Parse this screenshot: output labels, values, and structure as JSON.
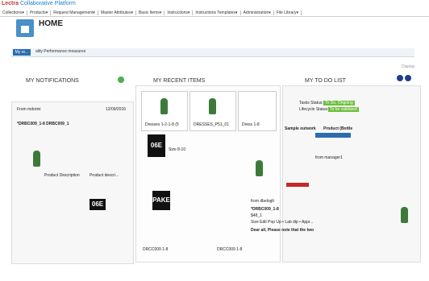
{
  "app": {
    "brand_prefix": "Lectra",
    "brand_name": "Collaborative Platform"
  },
  "topnav": [
    "Collections▾",
    "Products▾",
    "Request Management▾",
    "Master Attributes▾",
    "Basic Items▾",
    "Instructions▾",
    "Instructions Templates▾",
    "Administration▾",
    "File Library▾"
  ],
  "page": {
    "title": "HOME"
  },
  "filter": {
    "chip_label": "My re...",
    "text": "ality Performance measures"
  },
  "display_label": "Display",
  "tabs": {
    "notifications": "MY NOTIFICATIONS",
    "recent": "MY RECENT ITEMS",
    "todo": "MY TO DO LIST"
  },
  "notifications": {
    "from_label": "From mdorini",
    "date": "12/09/2016",
    "subject": "*DRBC009_1-8 DRBC009_1",
    "product_description_label": "Product Description",
    "product_description_value": "Product descri...",
    "big_code": "06E"
  },
  "recent": {
    "items": [
      {
        "label": "Dresses 1-2-1-8 (5"
      },
      {
        "label": "DRESSES_P51_01"
      },
      {
        "label": "Dress 1-8"
      }
    ],
    "size_label": "Size 8-10",
    "big_code": "06E",
    "code2": "PAKE",
    "bottom_label_1": "DRCC009 1-8",
    "bottom_label_2": "DRCC009 1-8"
  },
  "todo": {
    "task_status_label": "Tasks Status:",
    "task_status_value": "To Do, Ongoing",
    "lifecycle_label": "Lifecycle Status:",
    "lifecycle_value": "To be validated",
    "sample_link": "Sample outwork",
    "product_link": "Product (Bottle",
    "manager": "from manager1",
    "user": "from dbeloglt",
    "code": "*DRBC009_1-8",
    "short": "$48_1",
    "links": "Size Edit Pop Up • Lab dip • Appr...",
    "message": "Dear all, Please note that the two"
  },
  "colors": {
    "accent": "#2b6cb0",
    "brand": "#1a7fd1",
    "status_green": "#6bbf3a",
    "alert_red": "#c62828",
    "dress_green": "#3d7a3a"
  },
  "icons": {
    "home": "home-icon",
    "lock": "lock-icon"
  }
}
